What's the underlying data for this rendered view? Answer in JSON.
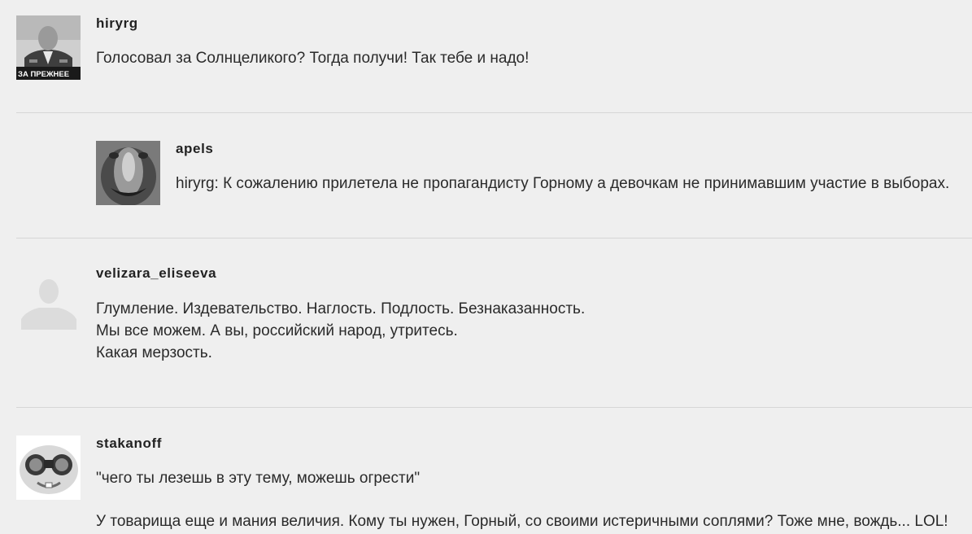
{
  "comments": [
    {
      "username": "hiryrg",
      "avatar_caption": "ЗА ПРЕЖНЕЕ",
      "lines": [
        "Голосовал за Солнцеликого? Тогда получи! Так тебе и надо!"
      ]
    },
    {
      "username": "apels",
      "lines": [
        "hiryrg: К сожалению прилетела не пропагандисту Горному а девочкам не принимавшим участие в выборах."
      ]
    },
    {
      "username": "velizara_eliseeva",
      "lines": [
        "Глумление. Издевательство. Наглость. Подлость. Безнаказанность.",
        "Мы все можем. А вы, российский народ, утритесь.",
        "Какая мерзость."
      ]
    },
    {
      "username": "stakanoff",
      "lines": [
        "\"чего ты лезешь в эту тему, можешь огрести\"",
        "У товарища еще и мания величия. Кому ты нужен, Горный, со своими истеричными соплями? Тоже мне, вождь... LOL!"
      ]
    }
  ],
  "colors": {
    "background": "#efefef",
    "divider": "#d6d6d6",
    "text": "#222222"
  }
}
